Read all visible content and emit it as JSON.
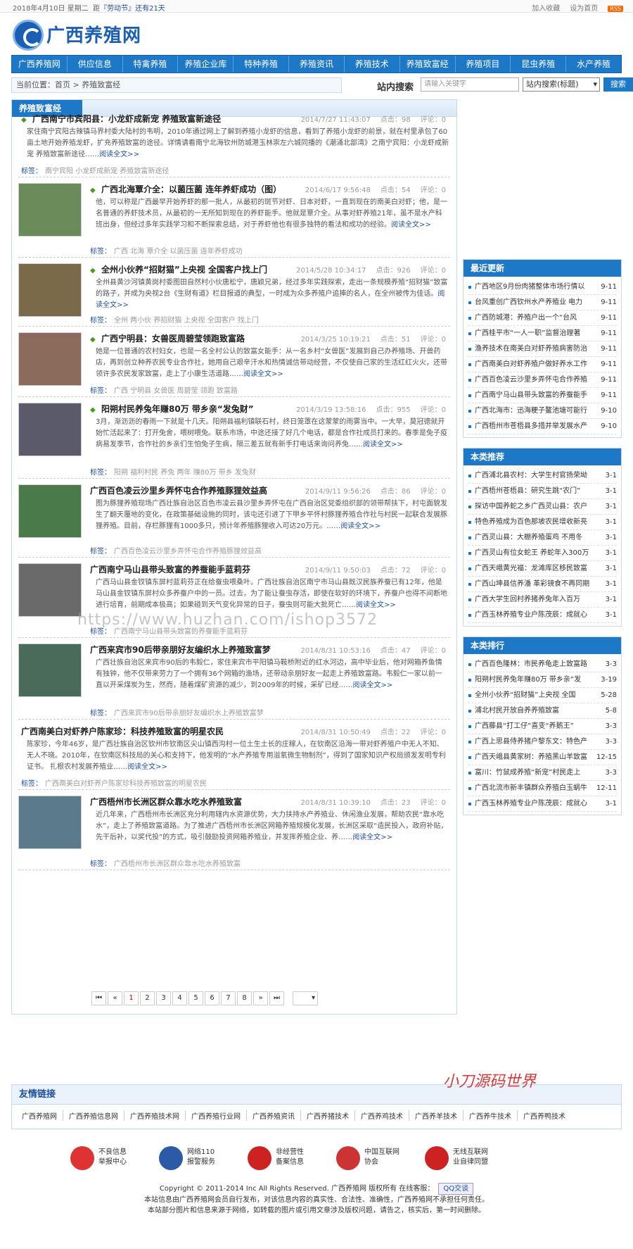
{
  "topbar": {
    "date": "2018年4月10日 星期二",
    "notice_pre": "距",
    "notice_link": "『劳动节』还有21天",
    "fav": "加入收藏",
    "home": "设为首页",
    "rss": "RSS"
  },
  "logo": {
    "text": "广西养殖网"
  },
  "nav": [
    "广西养殖网",
    "供应信息",
    "特禽养殖",
    "养殖企业库",
    "特种养殖",
    "养殖资讯",
    "养殖技术",
    "养殖致富经",
    "养殖项目",
    "昆虫养殖",
    "水产养殖"
  ],
  "crumb": "当前位置：首页 > 养殖致富经",
  "search": {
    "label": "站内搜索",
    "placeholder": "请输入关键字",
    "select": "站内搜索(标题)",
    "button": "搜索"
  },
  "main": {
    "title": "养殖致富经"
  },
  "articles": [
    {
      "title": "广西南宁市宾阳县：小龙虾成新宠 养殖致富新途径",
      "date": "2014/7/27 11:43:07",
      "hits": "点击：98",
      "comments": "评论：0",
      "summary": "家住南宁宾阳古辣镇马界村委大陆村的韦明，2010年通过网上了解到养殖小龙虾的信息，看到了养殖小龙虾的前景，就在村里承包了60亩土地开始养殖龙虾，扩充养殖致富的途径。详情请看南宁北海钦州防城港玉林崇左六城同播的《潮涌北部湾》之南宁宾阳：小龙虾成新宠 养殖致富新途径……",
      "more": "阅读全文>>",
      "tags": "南宁宾阳 小龙虾成新宠 养殖致富新途径"
    },
    {
      "title": "广西北海覃介全：以菌压菌 连年养虾成功（图）",
      "date": "2014/6/17 9:56:48",
      "hits": "点击：54",
      "comments": "评论：0",
      "summary": "他，可以称是广西最早开始养虾的那一批人，从最初的斑节对虾、日本对虾，一直到现在的南美白对虾；他，是一名普通的养虾技术员，从最初的一无所知到现在的养虾能手。他就是覃介全。从事对虾养殖21年，虽不是水产科班出身，但经过多年实践学习和不断探索总结，对于养虾他也有很多独特的看法和成功的经验。",
      "more": "阅读全文>>",
      "tags": "广西 北海 覃介全 以菌压菌 连年养虾成功"
    },
    {
      "title": "全州小伙养“招财猫”上央视 全国客户找上门",
      "date": "2014/5/28 10:34:17",
      "hits": "点击：926",
      "comments": "评论：0",
      "summary": "全州县黄沙河镇黄岗村委图田自然村小伙唐松宁，唐颖兄弟，经过多年实践探索，走出一条规模养殖“招财猫”致富的路子，并成为央视2台《生财有道》栏目报道的典型，一时成为众多养殖户追捧的名人，在全州被传为佳话。",
      "more": "阅读全文>>",
      "tags": "全州 两小伙 养招财猫 上央视 全国客户 找上门"
    },
    {
      "title": "广西宁明县：女兽医周碧莹领跑致富路",
      "date": "2014/3/25 10:19:21",
      "hits": "点击：51",
      "comments": "评论：0",
      "summary": "她是一位普通的农村妇女，也是一名全村公认的致富女能手：从一名乡村“女兽医”发展到自己办养殖场、开兽药店，再到创立种养农民专业合作社，她用自己艰辛汗水和热情诚信带动经营，不仅使自己家的生活红红火火，还带领许多农民发家致富，走上了小康生活道路……",
      "more": "阅读全文>>",
      "tags": "广西 宁明县 女兽医 周碧莹 领跑 致富路"
    },
    {
      "title": "阳朔村民养兔年赚80万 带乡亲“发兔财”",
      "date": "2014/3/19 13:58:16",
      "hits": "点击：955",
      "comments": "评论：0",
      "summary": "3月，渐沥沥的春雨一下就是十几天。阳朔县福利镇联石村，终日笼罩在这蒙蒙的雨雾当中。一大早，莫冠德就开始忙活起来了：打开兔舍，喂树喂兔。联系市场，中途还接了好几个电话，都是合作社成员打来的。春季是兔子疫病易发季节，合作社的乡亲们生怕兔子生病，隔三差五就有新手打电话来询问养兔……",
      "more": "阅读全文>>",
      "tags": "阳朔 福利村民 养兔 两年 赚80万 带乡 发兔财"
    },
    {
      "title": "广西百色凌云沙里乡弄怀屯合作养殖豚狸效益高",
      "date": "2014/9/11 9:56:26",
      "hits": "点击：86",
      "comments": "评论：0",
      "summary": "图为豚狸养殖现场广西壮族自治区百色市凌云县沙里乡弄怀屯在广西自治区党委组织部的领带帮扶下，村屯面貌发生了翻天覆地的变化，在政策基础设施的同时，该屯还引进了下甲乡平怀村豚狸养殖合作社与村民一起联合发展豚狸养殖。目前，存栏豚狸有1000多只，预计年养殖豚狸收入可达20万元。……",
      "more": "阅读全文>>",
      "tags": "广西百色凌云沙里乡弄怀屯合作养殖豚狸效益高"
    },
    {
      "title": "广西南宁马山县带头致富的养蚕能手蓝莉芬",
      "date": "2014/9/11 9:50:03",
      "hits": "点击：72",
      "comments": "评论：0",
      "summary": "广西马山县金钗镇东屏村蓝莉芬正在给蚕虫喂桑叶。广西壮族自治区南宁市马山县既汉民族养蚕已有12年，他是马山县金钗镇东屏村众多养蚕户中的一员。过去，为了能让蚕虫存活，即使在软好的环境下，养蚕户也得不间断地进行培育，前期成本极高；如果碰到天气变化异常的日子，蚕虫则可能大批死亡……",
      "more": "阅读全文>>",
      "tags": "广西南宁马山县带头致富的养蚕能手蓝莉芬"
    },
    {
      "title": "广西来宾市90后带亲朋好友编织水上养殖致富梦",
      "date": "2014/8/31 10:53:16",
      "hits": "点击：47",
      "comments": "评论：0",
      "summary": "广西壮族自治区来宾市90后的韦毅仁，家住来宾市平阳镇马鞍桥附近的红水河边，高中毕业后，他对网箱养鱼情有独钟，他不仅带来劳力了一个拥有36个网箱的渔场，还带动亲朋好友一起走上养殖致富路。韦毅仁一家以前一直以开采煤炭为生，然而，随着煤矿资源的减少，到2009年的时候，采矿已经……",
      "more": "阅读全文>>",
      "tags": "广西来宾市90后带亲朋好友编织水上养殖致富梦"
    },
    {
      "title": "广西南美白对虾养户陈家珍：科技养殖致富的明星农民",
      "date": "2014/8/31 10:50:49",
      "hits": "点击：22",
      "comments": "评论：0",
      "summary": "陈家珍，今年46岁，是广西壮族自治区钦州市钦南区尖山镇西沟村一位土生土长的庄稼人，在钦南区沿海一带对虾养殖户中无人不知、无人不晓。2010年，在钦南区科技局的关心和支持下，他发明的“水产养殖专用溢氧微生物制剂”，得到了国家知识产权局颁发发明专利证书。 扎根农村发展养殖业……",
      "more": "阅读全文>>",
      "tags": "广西南美白对虾养户陈家珍科技养殖致富的明星农民"
    },
    {
      "title": "广西梧州市长洲区群众靠水吃水养殖致富",
      "date": "2014/8/31 10:39:10",
      "hits": "点击：23",
      "comments": "评论：0",
      "summary": "近几年来，广西梧州市长洲区充分利用辖内水资源优势，大力扶持水产养殖业、休闲渔业发展，帮助农民“靠水吃水”，走上了养殖致富道路。为了推进广西梧州市长洲区网箱养殖规模化发展，长洲区采取“造民投入，政府补贴，先干后补，以奖代投”的方式，吸引鼓励投资网箱养殖业，并发挥养殖企业、养……",
      "more": "阅读全文>>",
      "tags": "广西梧州市长洲区群众靠水吃水养殖致富"
    }
  ],
  "tags_label": "标签：",
  "pager": [
    "⏮",
    "«",
    "1",
    "2",
    "3",
    "4",
    "5",
    "6",
    "7",
    "8",
    "»",
    "⏭"
  ],
  "side1": {
    "title": "最近更新",
    "items": [
      [
        "广西地区9月份肉猪整体市场行情以",
        "9-11"
      ],
      [
        "台风重创广西钦州水产养殖业 电力",
        "9-11"
      ],
      [
        "广西防城港：养殖户出一个“台风",
        "9-11"
      ],
      [
        "广西桂平市“一人一职”监督治理著",
        "9-11"
      ],
      [
        "渔养技术在南美白对虾养殖病害防治",
        "9-11"
      ],
      [
        "广西南美白对虾养殖户做好养水工作",
        "9-11"
      ],
      [
        "广西百色凌云沙里乡弄怀屯合作养殖",
        "9-11"
      ],
      [
        "广西南宁马山县带头致富的养蚕能手",
        "9-11"
      ],
      [
        "广西北海市：迅海粳子鳌池塘可能行",
        "9-10"
      ],
      [
        "广西梧州市苍梧县多措并举发展水产",
        "9-10"
      ]
    ]
  },
  "side2": {
    "title": "本类推荐",
    "items": [
      [
        "广西浦北县农村：大学生村官扬荣坳",
        "3-1"
      ],
      [
        "广西梧州苍梧县：研究生跳“农门”",
        "3-1"
      ],
      [
        "探访中国养蛇之乡广西灵山县：农户",
        "3-1"
      ],
      [
        "特色养殖成为百色那坡农民增收新亮",
        "3-1"
      ],
      [
        "广西灵山县：大棚养殖蛋鸡 不用冬",
        "3-1"
      ],
      [
        "广西灵山有位女蛇王 养蛇年入300万",
        "3-1"
      ],
      [
        "广西天峨黄光福：龙滩库区移民致富",
        "3-1"
      ],
      [
        "广西山坤县信养潘 革彩镜食不再同期",
        "3-1"
      ],
      [
        "广西大学生回村养猪养兔年入百万",
        "3-1"
      ],
      [
        "广西玉林养殖专业户陈茂辰：成就心",
        "3-1"
      ]
    ]
  },
  "side3": {
    "title": "本类排行",
    "items": [
      [
        "广西百色隆林：市民养龟走上致富路",
        "3-3"
      ],
      [
        "阳朔村民养兔年赚80万 带乡亲“发",
        "3-19"
      ],
      [
        "全州小伙养“招财猫”上央视 全国",
        "5-28"
      ],
      [
        "浦北村民开放自养养殖致富",
        "5-8"
      ],
      [
        "广西藤县“打工仔”喜变“养鹅王”",
        "3-3"
      ],
      [
        "广西上思县侍养猪户黎东文：特色产",
        "3-3"
      ],
      [
        "广西天峨县黄家树：养殖黑山羊致富",
        "12-15"
      ],
      [
        "富川：竹鼠成养殖“新宠”村民走上",
        "3-3"
      ],
      [
        "广西北流市新丰镇群众养殖白玉蜗牛",
        "12-11"
      ],
      [
        "广西玉林养殖专业户陈茂辰：成就心",
        "3-1"
      ]
    ]
  },
  "links": {
    "title": "友情链接",
    "items": [
      "广西养殖网",
      "广西养殖信息网",
      "广西养殖技术网",
      "广西养殖行业网",
      "广西养殖资讯",
      "广西养猪技术",
      "广西养鸡技术",
      "广西养羊技术",
      "广西养牛技术",
      "广西养鸭技术"
    ]
  },
  "watermark": "小刀源码世界",
  "watermark2": "https://www.huzhan.com/ishop3572",
  "badges": [
    [
      "不良信息",
      "举报中心"
    ],
    [
      "网络110",
      "报警服务"
    ],
    [
      "非经营性",
      "备案信息"
    ],
    [
      "中国互联网",
      "协会"
    ],
    [
      "无线互联网",
      "业自律同盟"
    ]
  ],
  "footer": {
    "line1": "Copyright © 2011-2014    Inc All Rights Reserved. 广西养殖网 版权所有 在线客服：",
    "qq": "QQ交谈",
    "line2": "本站信息由广西养殖网会员自行发布，对该信息内容的真实性、合法性、准确性，广西养殖网不承担任何责任。",
    "line3": "本站部分图片和信息来源于网络，如转载的图片或引用文章涉及版权问题，请告之，核实后，第一时间删除。"
  }
}
